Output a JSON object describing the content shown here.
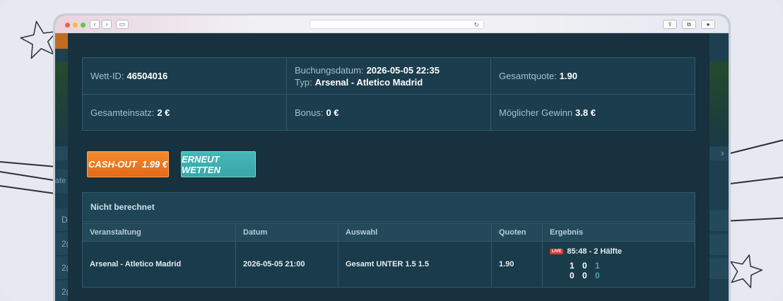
{
  "summary": {
    "wett_id_label": "Wett-ID:",
    "wett_id_value": "46504016",
    "buchungsdatum_label": "Buchungsdatum:",
    "buchungsdatum_value": "2026-05-05 22:35",
    "typ_label": "Typ:",
    "typ_value": "Arsenal - Atletico Madrid",
    "gesamtquote_label": "Gesamtquote:",
    "gesamtquote_value": "1.90",
    "gesamteinsatz_label": "Gesamteinsatz:",
    "gesamteinsatz_value": "2 €",
    "bonus_label": "Bonus:",
    "bonus_value": "0 €",
    "gewinn_label": "Möglicher Gewinn",
    "gewinn_value": "3.8 €"
  },
  "actions": {
    "cashout_label": "CASH-OUT  1.99 €",
    "again_label": "ERNEUT WETTEN"
  },
  "status_label": "Nicht berechnet",
  "table": {
    "headers": [
      "Veranstaltung",
      "Datum",
      "Auswahl",
      "Quoten",
      "Ergebnis"
    ],
    "row": {
      "event": "Arsenal - Atletico Madrid",
      "date": "2026-05-05 21:00",
      "selection": "Gesamt UNTER 1.5 1.5",
      "odds": "1.90",
      "live_badge": "LIVE",
      "live_time": "85:48 - 2 Hälfte",
      "score_home": [
        "1",
        "0",
        "1"
      ],
      "score_away": [
        "0",
        "0",
        "0"
      ]
    }
  },
  "background": {
    "left_tab_text": "ate",
    "left_rows": [
      "D",
      "2(",
      "2(",
      "2("
    ],
    "right_arrow": "›"
  },
  "colors": {
    "modal_bg": "#17313e",
    "cashout_orange": "#e26a1c",
    "again_teal": "#3aa6aa",
    "live_red": "#d63a3a"
  }
}
